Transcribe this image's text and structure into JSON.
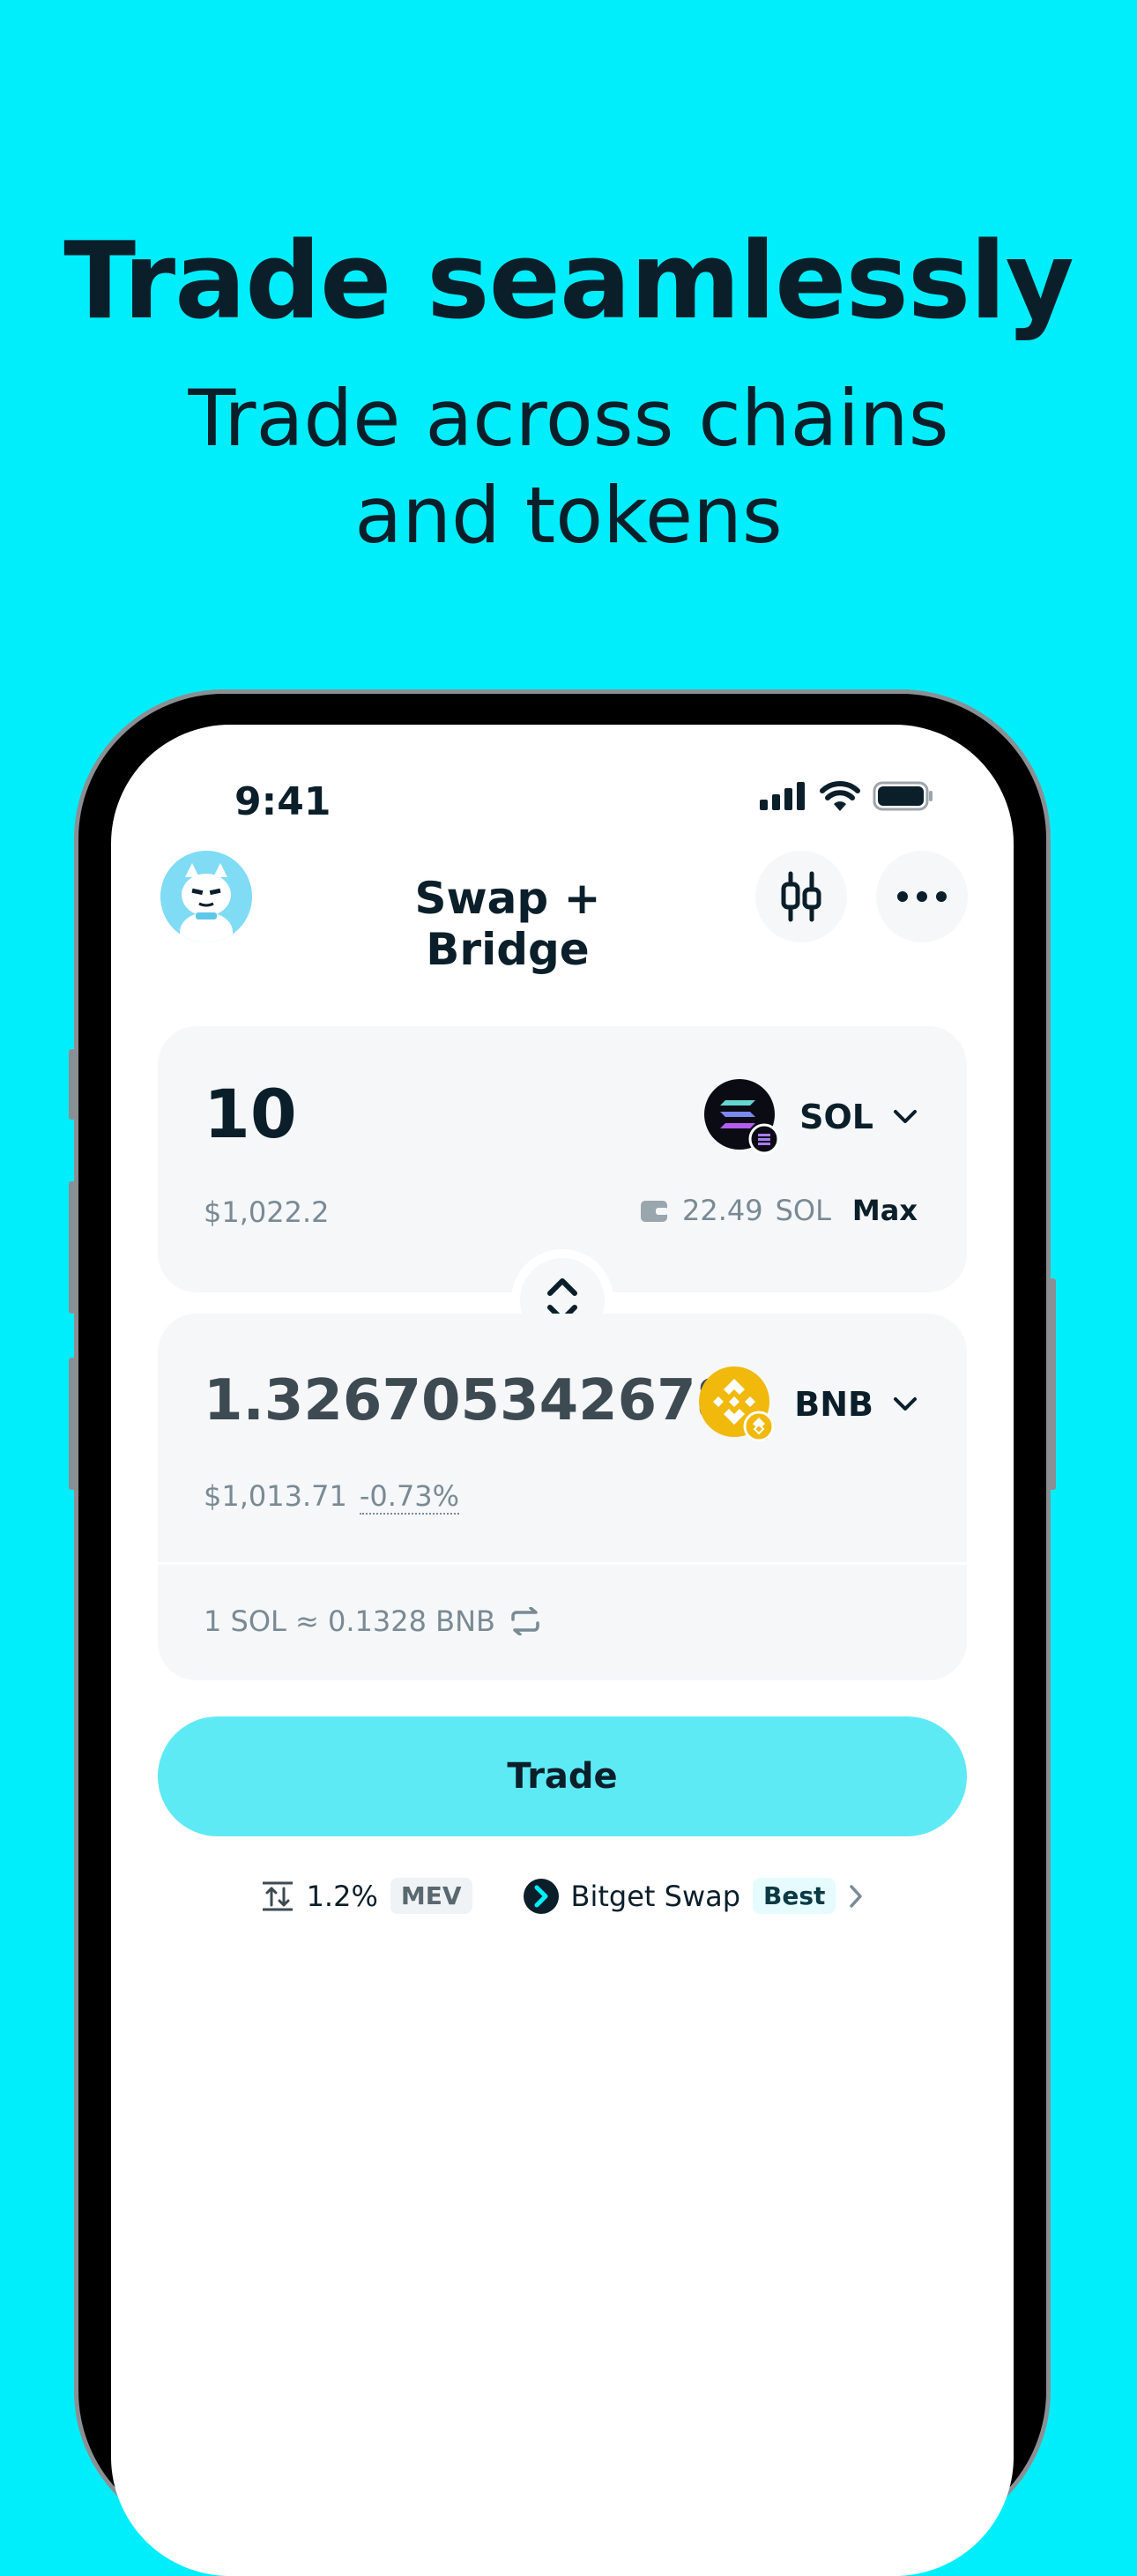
{
  "promo": {
    "headline": "Trade seamlessly",
    "subline_1": "Trade across chains",
    "subline_2": "and tokens"
  },
  "status_bar": {
    "time": "9:41"
  },
  "nav": {
    "title": "Swap + Bridge",
    "chart_icon": "candlestick-icon",
    "more_icon": "more-dots-icon"
  },
  "from_card": {
    "amount": "10",
    "usd_value": "$1,022.2",
    "token": "SOL",
    "balance": "22.49",
    "balance_token": "SOL",
    "max_label": "Max"
  },
  "to_card": {
    "amount": "1.326705342678",
    "usd_value": "$1,013.71",
    "change": "-0.73%",
    "token": "BNB",
    "rate": "1 SOL ≈ 0.1328 BNB"
  },
  "trade_button": {
    "label": "Trade"
  },
  "route": {
    "slippage": "1.2%",
    "mev_label": "MEV",
    "provider": "Bitget Swap",
    "best_label": "Best"
  },
  "colors": {
    "background": "#00EEFB",
    "primary_text": "#0B1F2A",
    "trade_button": "#5EEAF4",
    "card": "#F5F7F9",
    "bnb": "#F0B90B"
  }
}
